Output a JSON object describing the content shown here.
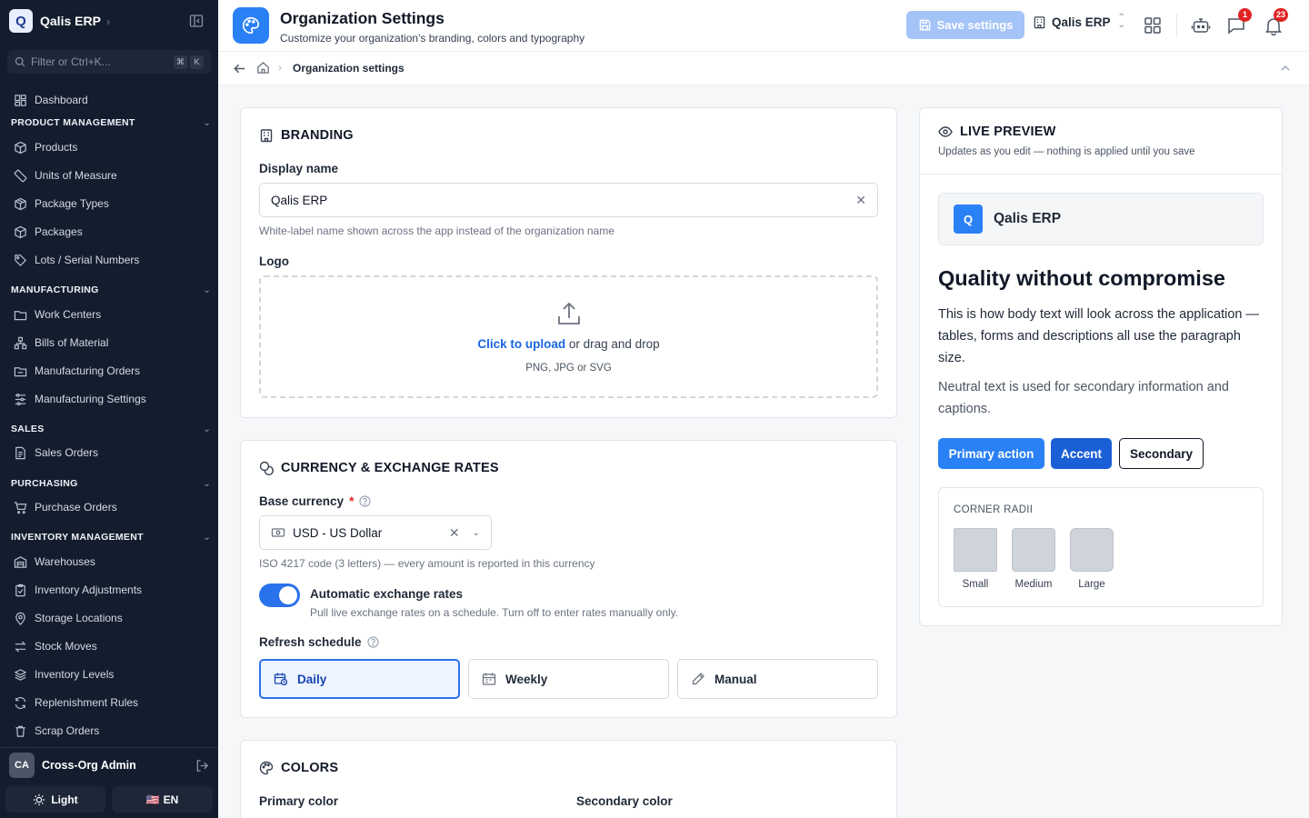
{
  "sidebar": {
    "logo_letter": "Q",
    "brand": "Qalis ERP",
    "brand_chevron": "›",
    "search_placeholder": "Filter or Ctrl+K...",
    "kbd1": "⌘",
    "kbd2": "K",
    "dashboard": "Dashboard",
    "sections": {
      "product": "PRODUCT MANAGEMENT",
      "manufacturing": "MANUFACTURING",
      "sales": "SALES",
      "purchasing": "PURCHASING",
      "inventory": "INVENTORY MANAGEMENT"
    },
    "items": {
      "products": "Products",
      "uom": "Units of Measure",
      "package_types": "Package Types",
      "packages": "Packages",
      "lots": "Lots / Serial Numbers",
      "work_centers": "Work Centers",
      "boms": "Bills of Material",
      "mos": "Manufacturing Orders",
      "mfg_settings": "Manufacturing Settings",
      "sales_orders": "Sales Orders",
      "purchase_orders": "Purchase Orders",
      "warehouses": "Warehouses",
      "adjustments": "Inventory Adjustments",
      "storage": "Storage Locations",
      "stock_moves": "Stock Moves",
      "levels": "Inventory Levels",
      "replenishment": "Replenishment Rules",
      "scrap": "Scrap Orders"
    },
    "user_initials": "CA",
    "user_name": "Cross-Org Admin",
    "theme_label": "Light",
    "language_flag": "🇺🇸",
    "language_label": "EN"
  },
  "header": {
    "title": "Organization Settings",
    "subtitle": "Customize your organization's branding, colors and typography",
    "save_label": "Save settings",
    "org_name": "Qalis ERP",
    "messages_badge": "1",
    "notifications_badge": "23"
  },
  "breadcrumb": {
    "current": "Organization settings"
  },
  "branding": {
    "title": "BRANDING",
    "display_name_label": "Display name",
    "display_name_value": "Qalis ERP",
    "display_name_help": "White-label name shown across the app instead of the organization name",
    "logo_label": "Logo",
    "upload_link": "Click to upload",
    "upload_rest": " or drag and drop",
    "upload_hint": "PNG, JPG or SVG"
  },
  "currency": {
    "title": "CURRENCY & EXCHANGE RATES",
    "base_label": "Base currency",
    "required_mark": "*",
    "base_value": "USD - US Dollar",
    "base_help": "ISO 4217 code (3 letters) — every amount is reported in this currency",
    "auto_label": "Automatic exchange rates",
    "auto_help": "Pull live exchange rates on a schedule. Turn off to enter rates manually only.",
    "auto_enabled": true,
    "schedule_label": "Refresh schedule",
    "options": [
      "Daily",
      "Weekly",
      "Manual"
    ],
    "selected": "Daily"
  },
  "colors": {
    "title": "COLORS",
    "primary_label": "Primary color",
    "secondary_label": "Secondary color"
  },
  "preview": {
    "title": "LIVE PREVIEW",
    "subtitle": "Updates as you edit — nothing is applied until you save",
    "logo_letter": "Q",
    "brand": "Qalis ERP",
    "heading": "Quality without compromise",
    "body": "This is how body text will look across the application — tables, forms and descriptions all use the paragraph size.",
    "neutral": "Neutral text is used for secondary information and captions.",
    "primary_btn": "Primary action",
    "accent_btn": "Accent",
    "secondary_btn": "Secondary",
    "radii_title": "CORNER RADII",
    "radii": [
      "Small",
      "Medium",
      "Large"
    ]
  },
  "theme_colors": {
    "sidebar_bg": "#141d2e",
    "primary": "#2a80f5",
    "accent": "#1a5fd6",
    "save_disabled": "#a4c3f7",
    "badge": "#e02424"
  }
}
